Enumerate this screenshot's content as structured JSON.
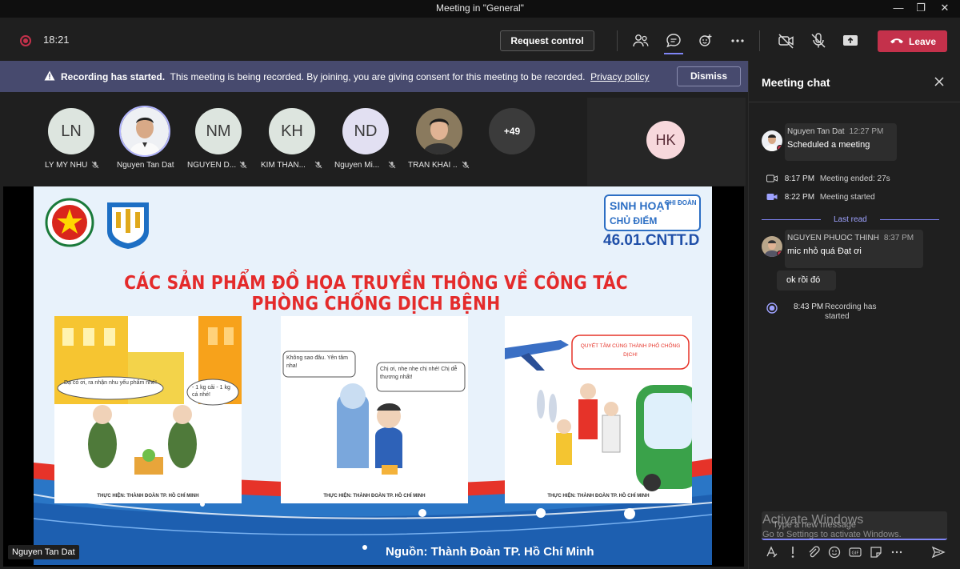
{
  "window": {
    "title": "Meeting in \"General\""
  },
  "toolbar": {
    "timer": "18:21",
    "request_control_label": "Request control",
    "leave_label": "Leave"
  },
  "banner": {
    "bold": "Recording has started.",
    "text": "This meeting is being recorded. By joining, you are giving consent for this meeting to be recorded.",
    "link": "Privacy policy",
    "dismiss_label": "Dismiss"
  },
  "participants": [
    {
      "initials": "LN",
      "name": "LY MY NHU",
      "muted": true
    },
    {
      "initials": "",
      "name": "Nguyen Tan Dat",
      "muted": false,
      "photo": true
    },
    {
      "initials": "NM",
      "name": "NGUYEN D...",
      "muted": true
    },
    {
      "initials": "KH",
      "name": "KIM THAN...",
      "muted": true
    },
    {
      "initials": "ND",
      "name": "Nguyen Mi...",
      "muted": true
    },
    {
      "initials": "",
      "name": "TRAN KHAI ...",
      "muted": true,
      "photo": true
    },
    {
      "initials": "+49",
      "name": ""
    }
  ],
  "side_participant": {
    "initials": "HK"
  },
  "slide": {
    "badge_line1": "SINH HOẠT",
    "badge_line2": "CHỦ ĐIỂM",
    "badge_line3": "CHI ĐOÀN",
    "class_code": "46.01.CNTT.D",
    "title": "CÁC SẢN PHẨM ĐỒ HỌA TRUYỀN THÔNG VỀ CÔNG TÁC PHÒNG CHỐNG DỊCH BỆNH",
    "panel1_bubble1": "Dạ có ơi, ra nhận nhu yếu phẩm nhé!",
    "panel1_bubble2": "- 1 kg cải - 1 kg cá nhé!",
    "panel2_bubble1": "Không sao đâu. Yên tâm nha!",
    "panel2_bubble2": "Chị ơi, nhẹ nhẹ chị nhé! Chị dễ thương nhất!",
    "panel3_bubble": "QUYẾT TÂM CÙNG THÀNH PHỐ CHỐNG DỊCH!",
    "credit": "THỰC HIỆN: THÀNH ĐOÀN TP. HỒ CHÍ MINH",
    "source": "Nguồn: Thành Đoàn TP. Hồ Chí Minh"
  },
  "speaker_tag": "Nguyen Tan Dat",
  "chat": {
    "header": "Meeting chat",
    "messages": [
      {
        "sender": "Nguyen Tan Dat",
        "time": "12:27 PM",
        "text": "Scheduled a meeting"
      },
      {
        "sender": "NGUYEN PHUOC THINH",
        "time": "8:37 PM",
        "text": "mic nhỏ quá Đạt ơi"
      },
      {
        "sender": "",
        "time": "",
        "text": "ok rồi đó"
      }
    ],
    "events": [
      {
        "time": "8:17 PM",
        "text": "Meeting ended: 27s"
      },
      {
        "time": "8:22 PM",
        "text": "Meeting started"
      },
      {
        "time": "8:43 PM",
        "text": "Recording has started"
      }
    ],
    "last_read": "Last read",
    "compose_placeholder": "Type a new message"
  },
  "watermark": {
    "line1": "Activate Windows",
    "line2": "Go to Settings to activate Windows."
  },
  "colors": {
    "accent": "#7f85f5",
    "leave": "#c4314b",
    "banner": "#474a6e",
    "slide_title": "#e42b2b"
  }
}
